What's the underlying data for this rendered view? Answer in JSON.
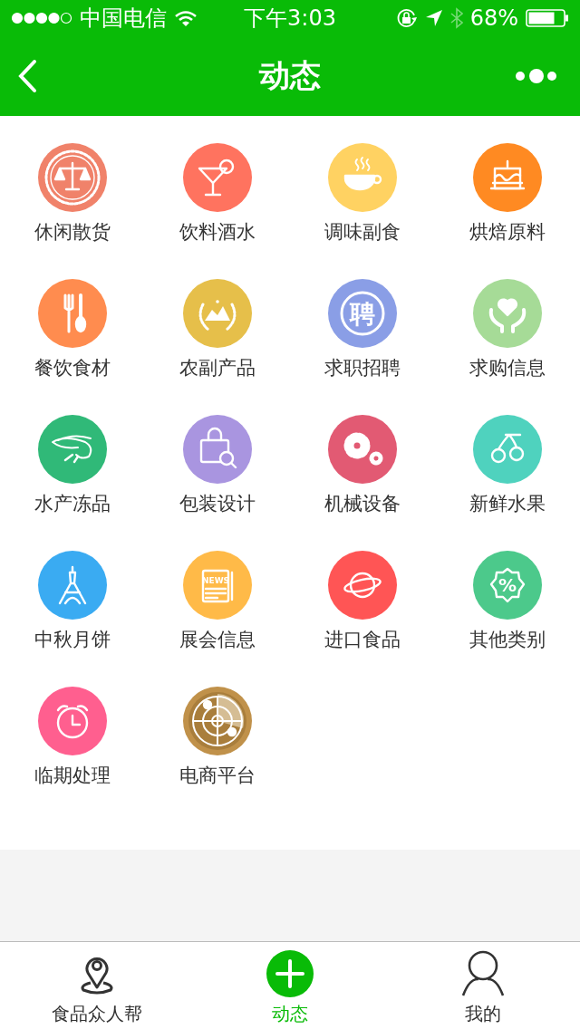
{
  "status_bar": {
    "carrier": "中国电信",
    "time": "下午3:03",
    "battery": "68%",
    "bluetooth_on": false
  },
  "nav_bar": {
    "title": "动态"
  },
  "categories": [
    {
      "label": "休闲散货",
      "color": "#f0826a",
      "kind": "scales"
    },
    {
      "label": "饮料酒水",
      "color": "#ff735f",
      "kind": "cocktail"
    },
    {
      "label": "调味副食",
      "color": "#ffd262",
      "kind": "cup"
    },
    {
      "label": "烘焙原料",
      "color": "#ff8a22",
      "kind": "cake"
    },
    {
      "label": "餐饮食材",
      "color": "#ff8c4f",
      "kind": "cutlery"
    },
    {
      "label": "农副产品",
      "color": "#e6bf4a",
      "kind": "mountains"
    },
    {
      "label": "求职招聘",
      "color": "#8a9ee6",
      "kind": "glyph",
      "icon_text": "聘"
    },
    {
      "label": "求购信息",
      "color": "#a6db97",
      "kind": "hands"
    },
    {
      "label": "水产冻品",
      "color": "#30b978",
      "kind": "shrimp"
    },
    {
      "label": "包装设计",
      "color": "#a995e0",
      "kind": "bag"
    },
    {
      "label": "机械设备",
      "color": "#e25a73",
      "kind": "gears"
    },
    {
      "label": "新鲜水果",
      "color": "#4fd2be",
      "kind": "cherries"
    },
    {
      "label": "中秋月饼",
      "color": "#3aabf2",
      "kind": "tower"
    },
    {
      "label": "展会信息",
      "color": "#ffba48",
      "kind": "newspaper",
      "icon_text": "NEWS"
    },
    {
      "label": "进口食品",
      "color": "#ff5555",
      "kind": "planet"
    },
    {
      "label": "其他类别",
      "color": "#4cc98b",
      "kind": "percent",
      "icon_text": "%"
    },
    {
      "label": "临期处理",
      "color": "#ff5f8f",
      "kind": "clock"
    },
    {
      "label": "电商平台",
      "color": "#c0914a",
      "kind": "radar"
    }
  ],
  "tab_bar": [
    {
      "label": "食品众人帮",
      "kind": "pin",
      "selected": false
    },
    {
      "label": "动态",
      "kind": "plus",
      "selected": true
    },
    {
      "label": "我的",
      "kind": "person",
      "selected": false
    }
  ]
}
